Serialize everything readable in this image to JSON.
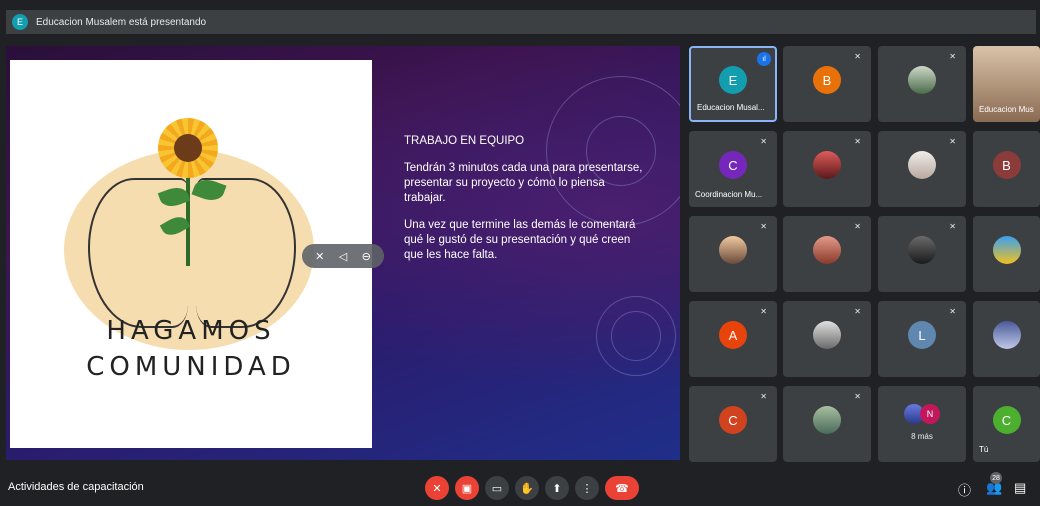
{
  "presenting_bar": {
    "avatar_letter": "E",
    "text": "Educacion Musalem está presentando"
  },
  "slide": {
    "title_line1": "HAGAMOS",
    "title_line2": "COMUNIDAD",
    "heading": "TRABAJO EN EQUIPO",
    "paragraph1": "Tendrán 3 minutos cada una para presentarse, presentar su proyecto y cómo lo piensa trabajar.",
    "paragraph2": "Una vez que termine las demás le comentará qué le gustó de su presentación y qué creen que les hace falta."
  },
  "participants": {
    "t1": {
      "letter": "E",
      "name": "Educacion Musal...",
      "color": "#129eaf"
    },
    "t2": {
      "letter": "B",
      "color": "#e8710a"
    },
    "t4": {
      "name": "Educacion Mus"
    },
    "t5": {
      "letter": "C",
      "name": "Coordinacion Mu...",
      "color": "#7627bb"
    },
    "t8": {
      "letter": "B",
      "color": "#8c3b3b"
    },
    "t13": {
      "letter": "A",
      "color": "#e8430a"
    },
    "t15": {
      "letter": "L",
      "color": "#5f87b0"
    },
    "t17": {
      "letter": "C",
      "color": "#d0431e"
    },
    "t19": {
      "more_letter": "N",
      "more_label": "8 más"
    },
    "t20": {
      "letter": "C",
      "name": "Tú",
      "color": "#4caf2f"
    }
  },
  "bottom": {
    "meeting_name": "Actividades de capacitación",
    "participant_count": "28"
  },
  "colors": {
    "accent": "#8ab4f8",
    "danger": "#ea4335",
    "tile": "#3c4043",
    "bg": "#202124"
  },
  "icons": {
    "mic_off": "mic-off-icon",
    "cam_off": "camera-off-icon",
    "captions": "captions-icon",
    "hand": "raise-hand-icon",
    "present": "present-icon",
    "more": "more-options-icon",
    "hangup": "end-call-icon",
    "info": "info-icon",
    "people": "people-icon",
    "chat": "chat-icon"
  }
}
